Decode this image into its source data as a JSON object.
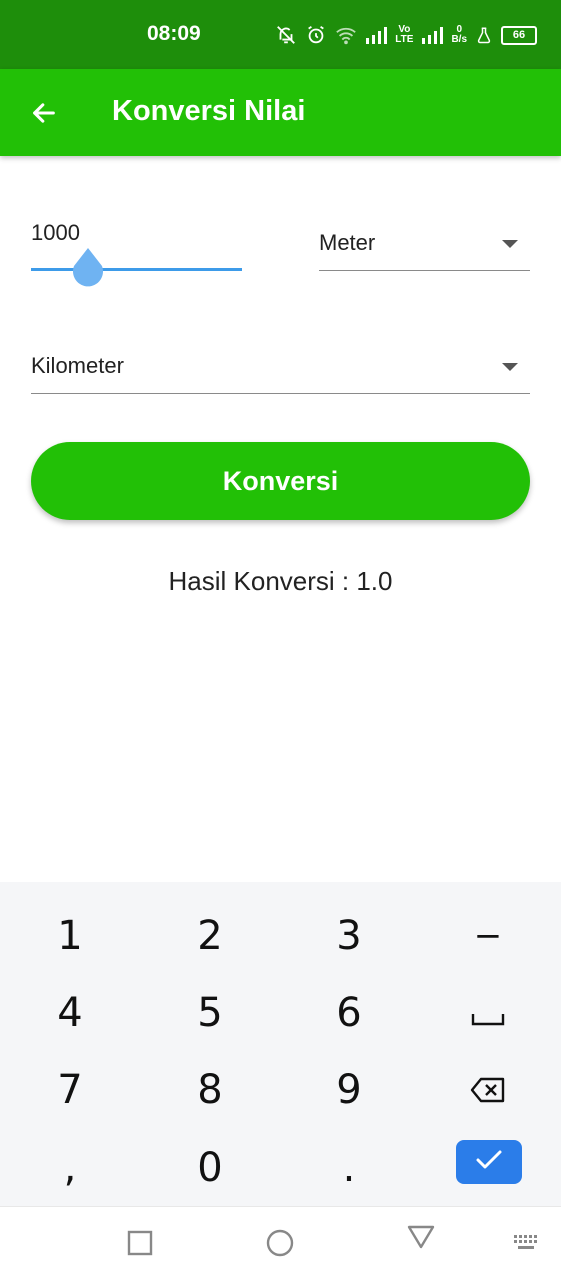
{
  "status_bar": {
    "time": "08:09",
    "network_top": "Vo",
    "network_bottom": "LTE",
    "speed_top": "0",
    "speed_bottom": "B/s",
    "battery": "66"
  },
  "app_bar": {
    "title": "Konversi Nilai",
    "back_icon": "arrow-left-icon"
  },
  "form": {
    "input_value": "1000",
    "from_unit": "Meter",
    "to_unit": "Kilometer",
    "convert_label": "Konversi",
    "result_text": "Hasil Konversi : 1.0"
  },
  "keyboard": {
    "keys": [
      "1",
      "2",
      "3",
      "−",
      "4",
      "5",
      "6",
      "␣",
      "7",
      "8",
      "9",
      "⌫",
      ",",
      "0",
      ".",
      "✓"
    ]
  },
  "colors": {
    "status_bar": "#1e8e0b",
    "app_bar": "#22c006",
    "button": "#22c006",
    "slider": "#3d9be9",
    "done_key": "#2b7de9"
  }
}
